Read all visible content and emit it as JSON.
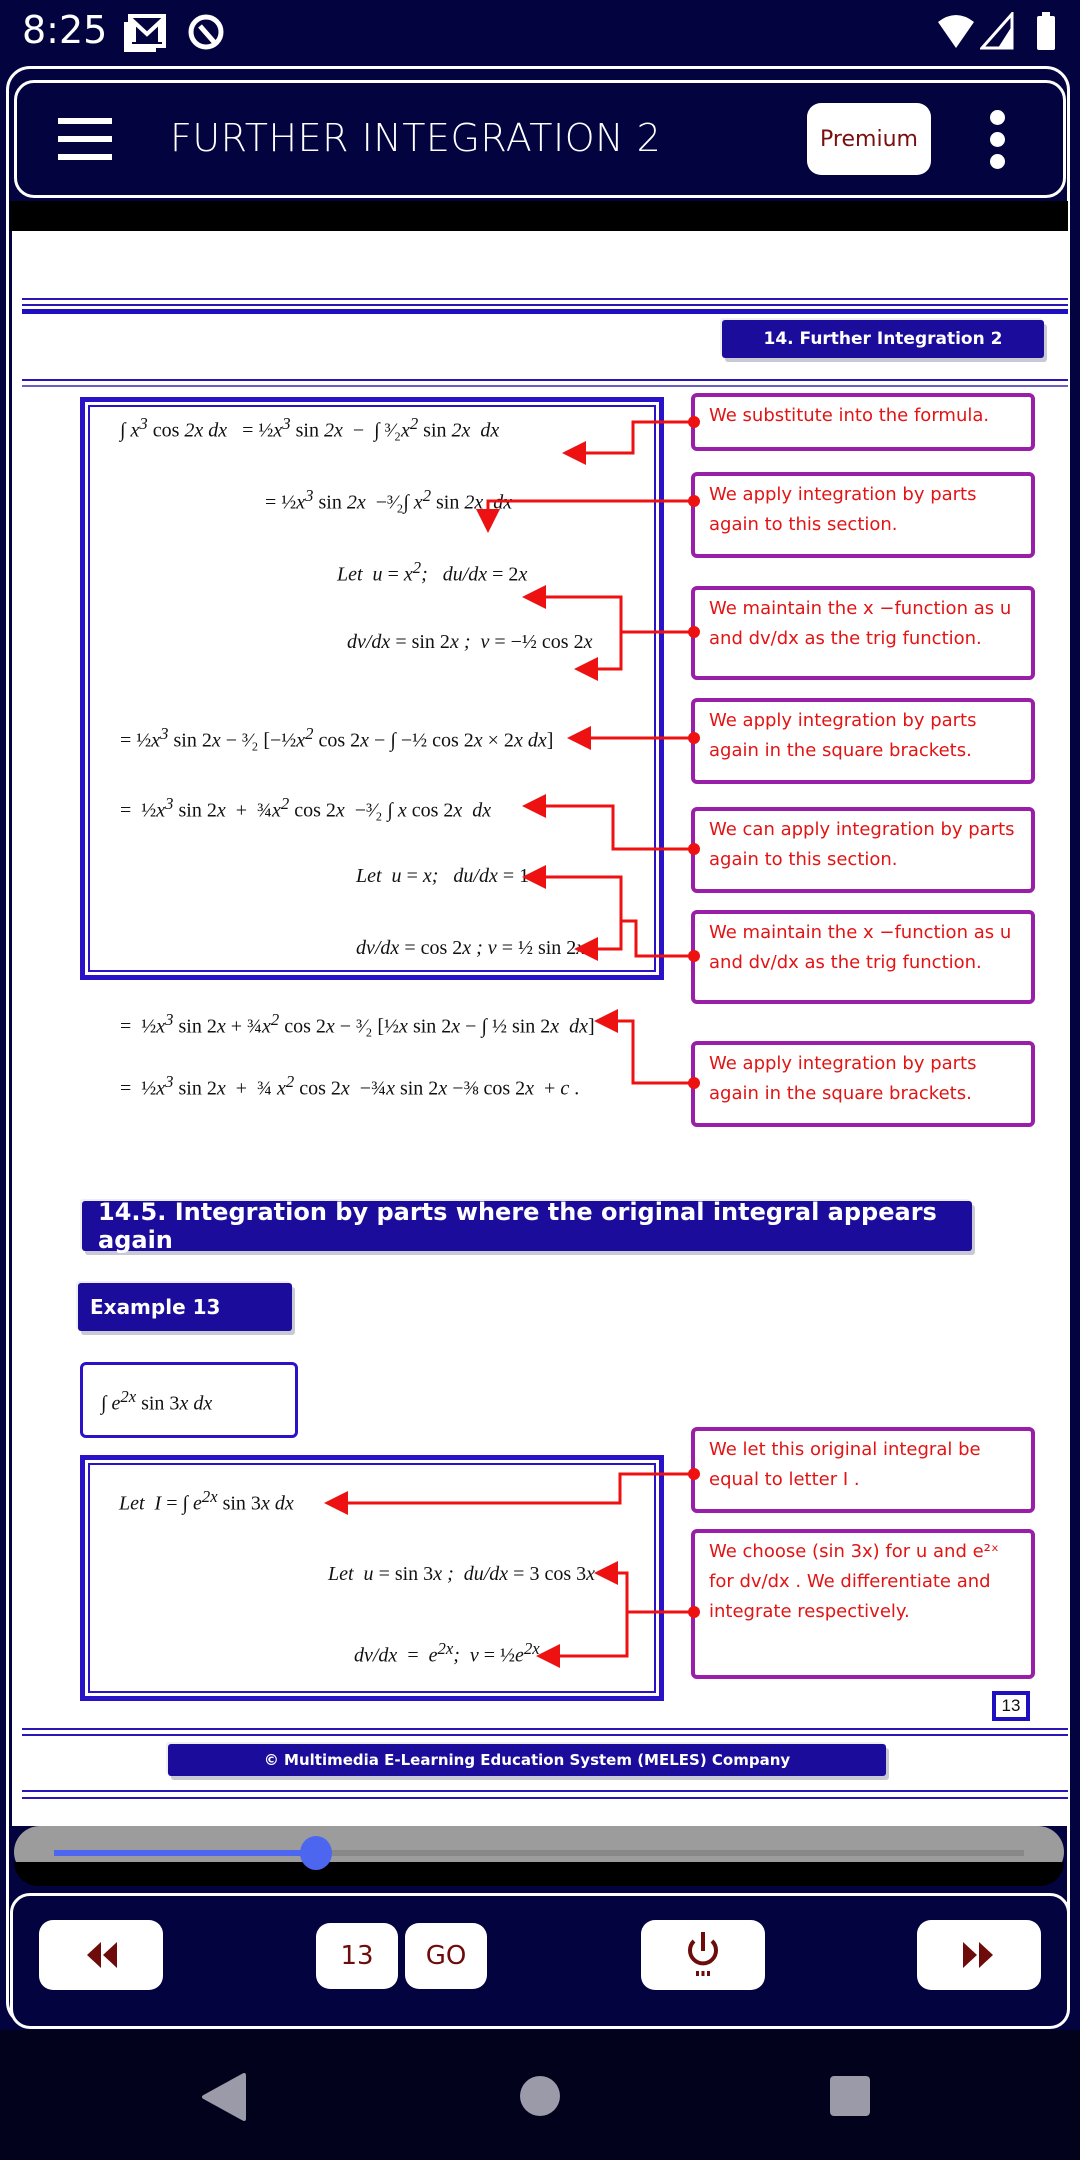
{
  "status_bar": {
    "time": "8:25",
    "left_icons": [
      "gmail-icon",
      "sync-icon"
    ],
    "right_icons": [
      "wifi-icon",
      "signal-icon",
      "battery-icon"
    ]
  },
  "app_bar": {
    "title": "FURTHER INTEGRATION 2",
    "premium_label": "Premium",
    "menu_icon": "hamburger-menu-icon",
    "overflow_icon": "more-vert-icon"
  },
  "page": {
    "chapter_banner": "14. Further Integration 2",
    "worked_example": {
      "lines": [
        "∫ x³ cos 2x dx  =  ½x³ sin 2x  −  ∫ (3/2)x² sin 2x  dx",
        "=  ½x³ sin 2x  − (3/2)∫ x² sin 2x  dx",
        "Let  u = x²;   du/dx = 2x",
        "dv/dx = sin 2x ;   v = −½ cos 2x",
        "= ½x³ sin 2x − (3/2)[−½x² cos 2x − ∫ −½ cos 2x × 2x dx]",
        "=  ½x³ sin 2x  +  ¾x² cos 2x  − (3/2) ∫ x cos 2x  dx",
        "Let  u = x;   du/dx = 1",
        "dv/dx = cos 2x ; v = ½ sin 2x",
        "=  ½x³ sin 2x + ¾x² cos 2x − (3/2)[½x sin 2x − ∫ ½ sin 2x  dx]",
        "=  ½x³ sin 2x  +  ¾ x² cos 2x  − ¾x sin 2x − ⅜ cos 2x   + c ."
      ],
      "notes": [
        "We substitute into the formula.",
        "We apply integration by parts again to this section.",
        "We maintain the x −function as u and dv/dx as the trig function.",
        "We apply integration by parts again in the square brackets.",
        "We can apply integration by parts again to this section.",
        "We maintain the x −function as u and dv/dx as the trig function.",
        "We apply integration by parts again in the square brackets."
      ]
    },
    "section_heading": "14.5. Integration by parts where the original integral appears again",
    "example_label": "Example 13",
    "example_integral": "∫ e²ˣ sin 3x dx",
    "example13": {
      "lines": [
        "Let  I = ∫ e²ˣ sin 3x dx",
        "Let  u = sin 3x ;  du/dx = 3 cos 3x",
        "dv/dx  =   e²ˣ;   v = ½e²ˣ"
      ],
      "notes": [
        "We let this original integral be equal to letter  I .",
        "We choose (sin 3x) for u and e²ˣ for dv/dx . We differentiate and integrate respectively."
      ]
    },
    "page_number": "13",
    "footer": "© Multimedia E-Learning Education System (MELES) Company"
  },
  "slider": {
    "progress_fraction": 0.27
  },
  "nav": {
    "prev_icon": "rewind-icon",
    "page_input_value": "13",
    "go_label": "GO",
    "power_icon": "power-icon",
    "next_icon": "fast-forward-icon"
  },
  "system_nav": [
    "back-icon",
    "home-icon",
    "recents-icon"
  ],
  "colors": {
    "app_bg": "#03033f",
    "banner": "#1c0c9c",
    "box_border": "#2a12c8",
    "note_border": "#9a1fa8",
    "note_text": "#e21414",
    "slider_accent": "#4c66f0",
    "nav_icon": "#6e0b0b"
  }
}
